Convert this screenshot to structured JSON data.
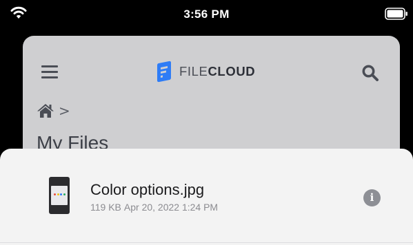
{
  "status_bar": {
    "time": "3:56 PM",
    "wifi_icon": "wifi-icon",
    "battery_icon": "battery-icon"
  },
  "header": {
    "menu_icon": "hamburger-menu-icon",
    "brand": {
      "logo_icon": "filecloud-logo-icon",
      "prefix": "FILE",
      "suffix": "CLOUD"
    },
    "search_icon": "search-icon"
  },
  "breadcrumb": {
    "home_icon": "home-icon",
    "separator": ">"
  },
  "page": {
    "title": "My Files"
  },
  "sheet": {
    "file": {
      "name": "Color options.jpg",
      "size": "119 KB",
      "modified": "Apr 20, 2022 1:24 PM",
      "thumbnail_icon": "image-thumbnail",
      "info_icon": "info-icon",
      "info_glyph": "i"
    }
  },
  "colors": {
    "brand_blue": "#2e7cf6",
    "dim_background": "#cfcfd1",
    "sheet_background": "#f3f3f3"
  }
}
